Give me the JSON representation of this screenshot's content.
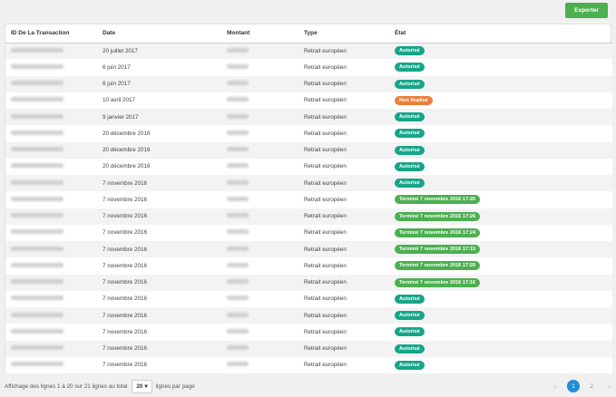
{
  "toolbar": {
    "export_label": "Exporter"
  },
  "table": {
    "headers": {
      "id": "ID De La Transaction",
      "date": "Date",
      "amount": "Montant",
      "type": "Type",
      "state": "État"
    },
    "rows": [
      {
        "date": "20 juillet 2017",
        "type": "Retrait européen",
        "state": "Autorisé",
        "state_color": "#17a589"
      },
      {
        "date": "6 juin 2017",
        "type": "Retrait européen",
        "state": "Autorisé",
        "state_color": "#17a589"
      },
      {
        "date": "6 juin 2017",
        "type": "Retrait européen",
        "state": "Autorisé",
        "state_color": "#17a589"
      },
      {
        "date": "10 avril 2017",
        "type": "Retrait européen",
        "state": "Non finalisé",
        "state_color": "#e8803a"
      },
      {
        "date": "9 janvier 2017",
        "type": "Retrait européen",
        "state": "Autorisé",
        "state_color": "#17a589"
      },
      {
        "date": "20 décembre 2016",
        "type": "Retrait européen",
        "state": "Autorisé",
        "state_color": "#17a589"
      },
      {
        "date": "20 décembre 2016",
        "type": "Retrait européen",
        "state": "Autorisé",
        "state_color": "#17a589"
      },
      {
        "date": "20 décembre 2016",
        "type": "Retrait européen",
        "state": "Autorisé",
        "state_color": "#17a589"
      },
      {
        "date": "7 novembre 2016",
        "type": "Retrait européen",
        "state": "Autorisé",
        "state_color": "#17a589"
      },
      {
        "date": "7 novembre 2016",
        "type": "Retrait européen",
        "state": "Terminé 7 novembre 2016 17:26",
        "state_color": "#4caf50"
      },
      {
        "date": "7 novembre 2016",
        "type": "Retrait européen",
        "state": "Terminé 7 novembre 2016 17:26",
        "state_color": "#4caf50"
      },
      {
        "date": "7 novembre 2016",
        "type": "Retrait européen",
        "state": "Terminé 7 novembre 2016 17:24",
        "state_color": "#4caf50"
      },
      {
        "date": "7 novembre 2016",
        "type": "Retrait européen",
        "state": "Terminé 7 novembre 2016 17:15",
        "state_color": "#4caf50"
      },
      {
        "date": "7 novembre 2016",
        "type": "Retrait européen",
        "state": "Terminé 7 novembre 2016 17:20",
        "state_color": "#4caf50"
      },
      {
        "date": "7 novembre 2016",
        "type": "Retrait européen",
        "state": "Terminé 7 novembre 2016 17:16",
        "state_color": "#4caf50"
      },
      {
        "date": "7 novembre 2016",
        "type": "Retrait européen",
        "state": "Autorisé",
        "state_color": "#17a589"
      },
      {
        "date": "7 novembre 2016",
        "type": "Retrait européen",
        "state": "Autorisé",
        "state_color": "#17a589"
      },
      {
        "date": "7 novembre 2016",
        "type": "Retrait européen",
        "state": "Autorisé",
        "state_color": "#17a589"
      },
      {
        "date": "7 novembre 2016",
        "type": "Retrait européen",
        "state": "Autorisé",
        "state_color": "#17a589"
      },
      {
        "date": "7 novembre 2016",
        "type": "Retrait européen",
        "state": "Autorisé",
        "state_color": "#17a589"
      }
    ]
  },
  "footer": {
    "summary": "Affichage des lignes 1 à 20 sur 21 lignes au total",
    "page_size": "20",
    "page_size_suffix": "lignes par page",
    "prev_icon": "‹",
    "next_icon": "›",
    "pages": [
      "1",
      "2"
    ],
    "active_page": "1"
  }
}
